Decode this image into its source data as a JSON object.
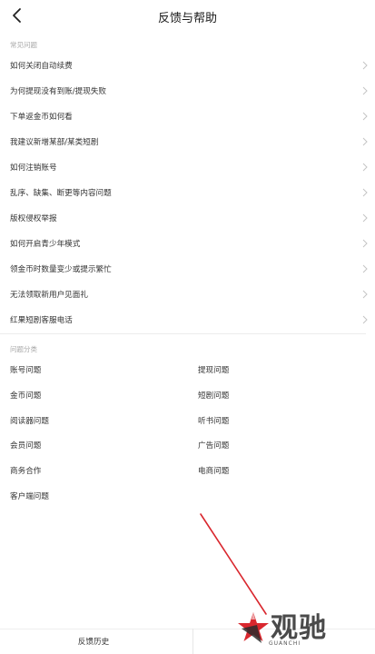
{
  "header": {
    "title": "反馈与帮助"
  },
  "faq": {
    "section_label": "常见问题",
    "items": [
      "如何关闭自动续费",
      "为何提现没有到账/提现失败",
      "下单返金币如何看",
      "我建议新增某部/某类短剧",
      "如何注销账号",
      "乱序、缺集、断更等内容问题",
      "版权侵权举报",
      "如何开启青少年模式",
      "领金币时数量变少或提示繁忙",
      "无法领取新用户见面礼",
      "红果短剧客服电话"
    ]
  },
  "categories": {
    "section_label": "问题分类",
    "left": [
      "账号问题",
      "金币问题",
      "阅读器问题",
      "会员问题",
      "商务合作",
      "客户端问题"
    ],
    "right": [
      "提现问题",
      "短剧问题",
      "听书问题",
      "广告问题",
      "电商问题"
    ]
  },
  "bottom_bar": {
    "history_label": "反馈历史"
  },
  "watermark": {
    "name": "观驰",
    "sub": "GUANCHI"
  },
  "colors": {
    "annotation": "#d9272e",
    "watermark_star": "#d9272e",
    "text": "#333333",
    "muted": "#a8a8a8"
  }
}
